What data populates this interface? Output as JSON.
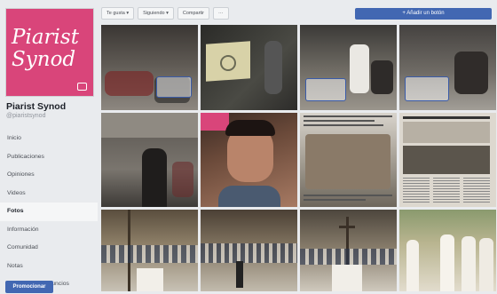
{
  "page": {
    "name": "Piarist Synod",
    "handle": "@piaristsynod",
    "logo_line1": "Piarist",
    "logo_line2": "Synod"
  },
  "nav": {
    "items": [
      {
        "label": "Inicio"
      },
      {
        "label": "Publicaciones"
      },
      {
        "label": "Opiniones"
      },
      {
        "label": "Videos"
      },
      {
        "label": "Fotos",
        "active": true
      },
      {
        "label": "Información"
      },
      {
        "label": "Comunidad"
      },
      {
        "label": "Notas"
      },
      {
        "label": "Información y anuncios"
      }
    ],
    "promote_label": "Promocionar"
  },
  "topbar": {
    "like_label": "Te gusta ▾",
    "follow_label": "Siguiendo ▾",
    "share_label": "Compartir",
    "more_label": "···",
    "add_button_label": "+ Añadir un botón"
  },
  "colors": {
    "brand_pink": "#d9457a",
    "facebook_blue": "#4267b2",
    "background": "#e9ebee"
  },
  "photos": [
    {
      "name": "photo-classroom-1"
    },
    {
      "name": "photo-projector"
    },
    {
      "name": "photo-classroom-2"
    },
    {
      "name": "photo-classroom-3"
    },
    {
      "name": "photo-hall-youth"
    },
    {
      "name": "photo-young-man-portrait"
    },
    {
      "name": "photo-newspaper-group"
    },
    {
      "name": "photo-newspaper-article"
    },
    {
      "name": "photo-chapel-1"
    },
    {
      "name": "photo-chapel-2"
    },
    {
      "name": "photo-chapel-3"
    },
    {
      "name": "photo-procession"
    }
  ]
}
